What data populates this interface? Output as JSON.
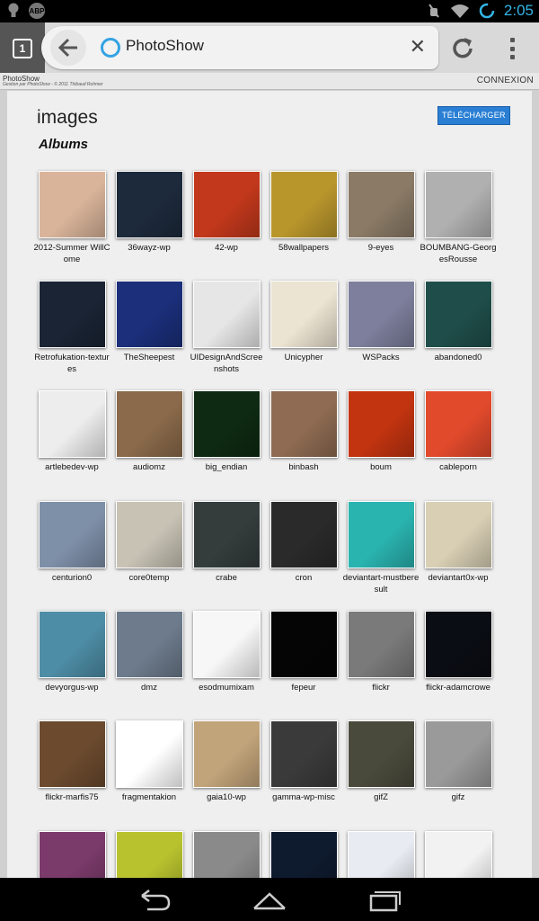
{
  "status_bar": {
    "time": "2:05",
    "left_icons": [
      "lightbulb-icon",
      "adblock-icon"
    ],
    "adblock_label": "ABP",
    "right_icons": [
      "mute-icon",
      "wifi-icon",
      "sync-icon"
    ]
  },
  "browser": {
    "tab_count": "1",
    "url_title": "PhotoShow"
  },
  "site": {
    "name": "PhotoShow",
    "credit": "Gestion par PhotoShow - © 2011 Thibaud Rohmer",
    "login": "CONNEXION"
  },
  "page": {
    "title": "images",
    "upload_button": "TÉLÉCHARGER",
    "section": "Albums"
  },
  "albums": [
    {
      "label": "2012-Summer WillCome"
    },
    {
      "label": "36wayz-wp"
    },
    {
      "label": "42-wp"
    },
    {
      "label": "58wallpapers"
    },
    {
      "label": "9-eyes"
    },
    {
      "label": "BOUMBANG-GeorgesRousse"
    },
    {
      "label": "Retrofukation-textures"
    },
    {
      "label": "TheSheepest"
    },
    {
      "label": "UIDesignAndScreenshots"
    },
    {
      "label": "Unicypher"
    },
    {
      "label": "WSPacks"
    },
    {
      "label": "abandoned0"
    },
    {
      "label": "artlebedev-wp"
    },
    {
      "label": "audiomz"
    },
    {
      "label": "big_endian"
    },
    {
      "label": "binbash"
    },
    {
      "label": "boum"
    },
    {
      "label": "cableporn"
    },
    {
      "label": "centurion0"
    },
    {
      "label": "core0temp"
    },
    {
      "label": "crabe"
    },
    {
      "label": "cron"
    },
    {
      "label": "deviantart-mustberesult"
    },
    {
      "label": "deviantart0x-wp"
    },
    {
      "label": "devyorgus-wp"
    },
    {
      "label": "dmz"
    },
    {
      "label": "esodmumixam"
    },
    {
      "label": "fepeur"
    },
    {
      "label": "flickr"
    },
    {
      "label": "flickr-adamcrowe"
    },
    {
      "label": "flickr-marfis75"
    },
    {
      "label": "fragmentakion"
    },
    {
      "label": "gaia10-wp"
    },
    {
      "label": "gamma-wp-misc"
    },
    {
      "label": "gifZ"
    },
    {
      "label": "gifz"
    },
    {
      "label": ""
    },
    {
      "label": ""
    },
    {
      "label": ""
    },
    {
      "label": ""
    },
    {
      "label": ""
    },
    {
      "label": ""
    }
  ],
  "thumb_colors": [
    "#d9b49a",
    "#1d2a3c",
    "#c2381c",
    "#b9962c",
    "#8a7a66",
    "#b0b0b0",
    "#1a2434",
    "#1b2f7a",
    "#e6e6e6",
    "#ece4d2",
    "#7d7f9c",
    "#1f4e4a",
    "#ededed",
    "#8a6a4a",
    "#0e2a12",
    "#8e6b52",
    "#c23410",
    "#e24a2c",
    "#7e8fa8",
    "#c7c2b4",
    "#343c3c",
    "#2a2a2a",
    "#2ab4b0",
    "#d8cfb4",
    "#4d8da6",
    "#6d7b8c",
    "#f7f7f7",
    "#050505",
    "#7a7a7a",
    "#0b0d14",
    "#6b4a2e",
    "#ffffff",
    "#c2a47a",
    "#3a3a3a",
    "#4a4a3c",
    "#9a9a9a",
    "#7a3a6a",
    "#b8c22e",
    "#8a8a8a",
    "#0e1a2e",
    "#e8ecf2",
    "#f2f2f2"
  ],
  "nav": {
    "back": "back-nav-icon",
    "home": "home-nav-icon",
    "recents": "recents-nav-icon"
  }
}
